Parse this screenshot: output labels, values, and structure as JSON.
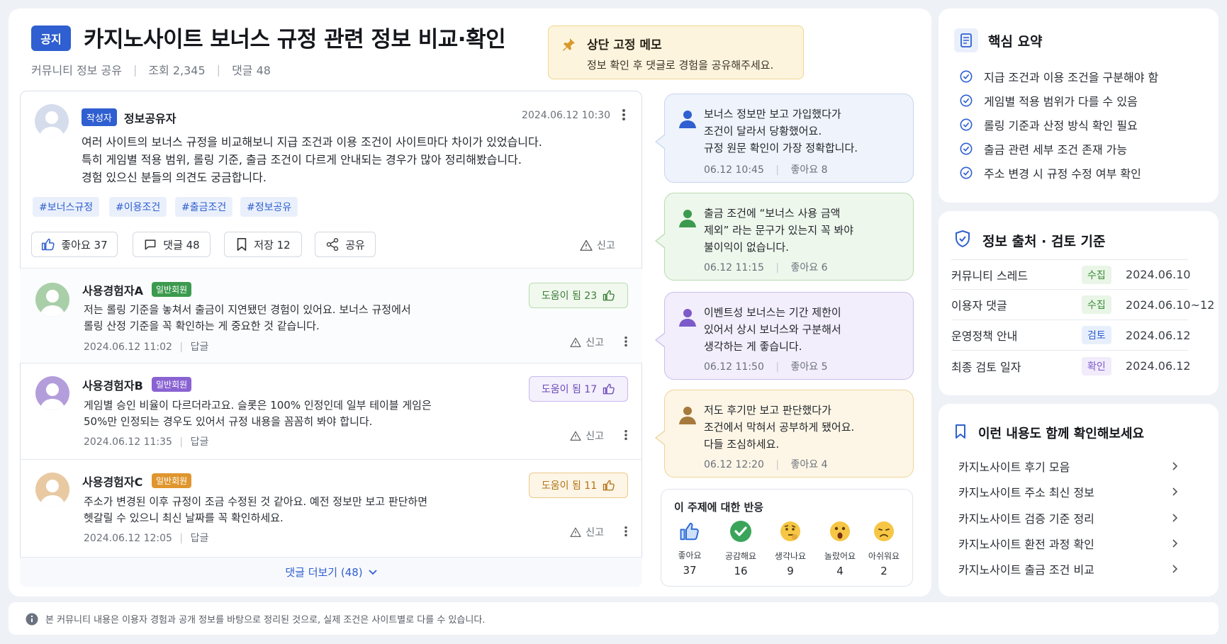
{
  "header": {
    "badge": "공지",
    "title": "카지노사이트 보너스 규정 관련 정보 비교·확인",
    "category": "커뮤니티 정보 공유",
    "views": "조회 2,345",
    "comments": "댓글 48"
  },
  "pinned": {
    "title": "상단 고정 메모",
    "body": "정보 확인 후 댓글로 경험을 공유해주세요."
  },
  "post": {
    "author_badge": "작성자",
    "author": "정보공유자",
    "time": "2024.06.12  10:30",
    "body": [
      "여러 사이트의 보너스 규정을 비교해보니 지급 조건과 이용 조건이 사이트마다 차이가 있었습니다.",
      "특히 게임별 적용 범위, 롤링 기준, 출금 조건이 다르게 안내되는 경우가 많아 정리해봤습니다.",
      "경험 있으신 분들의 의견도 궁금합니다."
    ],
    "tags": [
      "#보너스규정",
      "#이용조건",
      "#출금조건",
      "#정보공유"
    ],
    "actions": {
      "like": "좋아요  37",
      "comment": "댓글  48",
      "save": "저장  12",
      "share": "공유",
      "report": "신고"
    }
  },
  "comments": [
    {
      "name": "사용경험자A",
      "badge": "일반회원",
      "body": [
        "저는 롤링 기준을 놓쳐서 출금이 지연됐던 경험이 있어요. 보너스 규정에서",
        "롤링 산정 기준을 꼭 확인하는 게 중요한 것 같습니다."
      ],
      "time": "2024.06.12  11:02",
      "reply": "답글",
      "helpful": "도움이 됨 23",
      "report": "신고"
    },
    {
      "name": "사용경험자B",
      "badge": "일반회원",
      "body": [
        "게임별 승인 비율이 다르더라고요. 슬롯은 100% 인정인데 일부 테이블 게임은",
        "50%만 인정되는 경우도 있어서 규정 내용을 꼼꼼히 봐야 합니다."
      ],
      "time": "2024.06.12  11:35",
      "reply": "답글",
      "helpful": "도움이 됨 17",
      "report": "신고"
    },
    {
      "name": "사용경험자C",
      "badge": "일반회원",
      "body": [
        "주소가 변경된 이후 규정이 조금 수정된 것 같아요. 예전 정보만 보고 판단하면",
        "헷갈릴 수 있으니 최신 날짜를 꼭 확인하세요."
      ],
      "time": "2024.06.12  12:05",
      "reply": "답글",
      "helpful": "도움이 됨 11",
      "report": "신고"
    }
  ],
  "more_comments": "댓글 더보기 (48)",
  "chat": [
    {
      "lines": [
        "보너스 정보만 보고 가입했다가",
        "조건이 달라서 당황했어요.",
        "규정 원문 확인이 가장 정확합니다."
      ],
      "time": "06.12  10:45",
      "likes": "좋아요  8",
      "color": "#2f5fd0"
    },
    {
      "lines": [
        "출금 조건에 “보너스 사용 금액",
        "제외” 라는 문구가 있는지 꼭 봐야",
        "불이익이 없습니다."
      ],
      "time": "06.12  11:15",
      "likes": "좋아요  6",
      "color": "#3c9a4e"
    },
    {
      "lines": [
        "이벤트성 보너스는 기간 제한이",
        "있어서 상시 보너스와 구분해서",
        "생각하는 게 좋습니다."
      ],
      "time": "06.12  11:50",
      "likes": "좋아요  5",
      "color": "#7c5ac9"
    },
    {
      "lines": [
        "저도 후기만 보고 판단했다가",
        "조건에서 막혀서 공부하게 됐어요.",
        "다들 조심하세요."
      ],
      "time": "06.12  12:20",
      "likes": "좋아요  4",
      "color": "#a57a3c"
    }
  ],
  "reactions": {
    "title": "이 주제에 대한 반응",
    "items": [
      {
        "label": "좋아요",
        "count": "37",
        "icon": "thumbs-up"
      },
      {
        "label": "공감해요",
        "count": "16",
        "icon": "check-mark"
      },
      {
        "label": "생각나요",
        "count": "9",
        "icon": "thinking-face"
      },
      {
        "label": "놀랐어요",
        "count": "4",
        "icon": "surprised-face"
      },
      {
        "label": "아쉬워요",
        "count": "2",
        "icon": "sad-face"
      }
    ]
  },
  "summary": {
    "title": "핵심 요약",
    "items": [
      "지급 조건과 이용 조건을 구분해야 함",
      "게임별 적용 범위가 다를 수 있음",
      "롤링 기준과 산정 방식 확인 필요",
      "출금 관련 세부 조건 존재 가능",
      "주소 변경 시 규정 수정 여부 확인"
    ]
  },
  "sources": {
    "title": "정보 출처 · 검토 기준",
    "rows": [
      {
        "name": "커뮤니티 스레드",
        "status": "수집",
        "date": "2024.06.10"
      },
      {
        "name": "이용자 댓글",
        "status": "수집",
        "date": "2024.06.10~12"
      },
      {
        "name": "운영정책 안내",
        "status": "검토",
        "date": "2024.06.12"
      },
      {
        "name": "최종 검토 일자",
        "status": "확인",
        "date": "2024.06.12"
      }
    ]
  },
  "related": {
    "title": "이런 내용도 함께 확인해보세요",
    "items": [
      "카지노사이트 후기 모음",
      "카지노사이트 주소 최신 정보",
      "카지노사이트 검증 기준 정리",
      "카지노사이트 환전 과정 확인",
      "카지노사이트 출금 조건 비교"
    ]
  },
  "footer": "본 커뮤니티 내용은 이용자 경험과 공개 정보를 바탕으로 정리된 것으로, 실제 조건은 사이트별로 다를 수 있습니다."
}
